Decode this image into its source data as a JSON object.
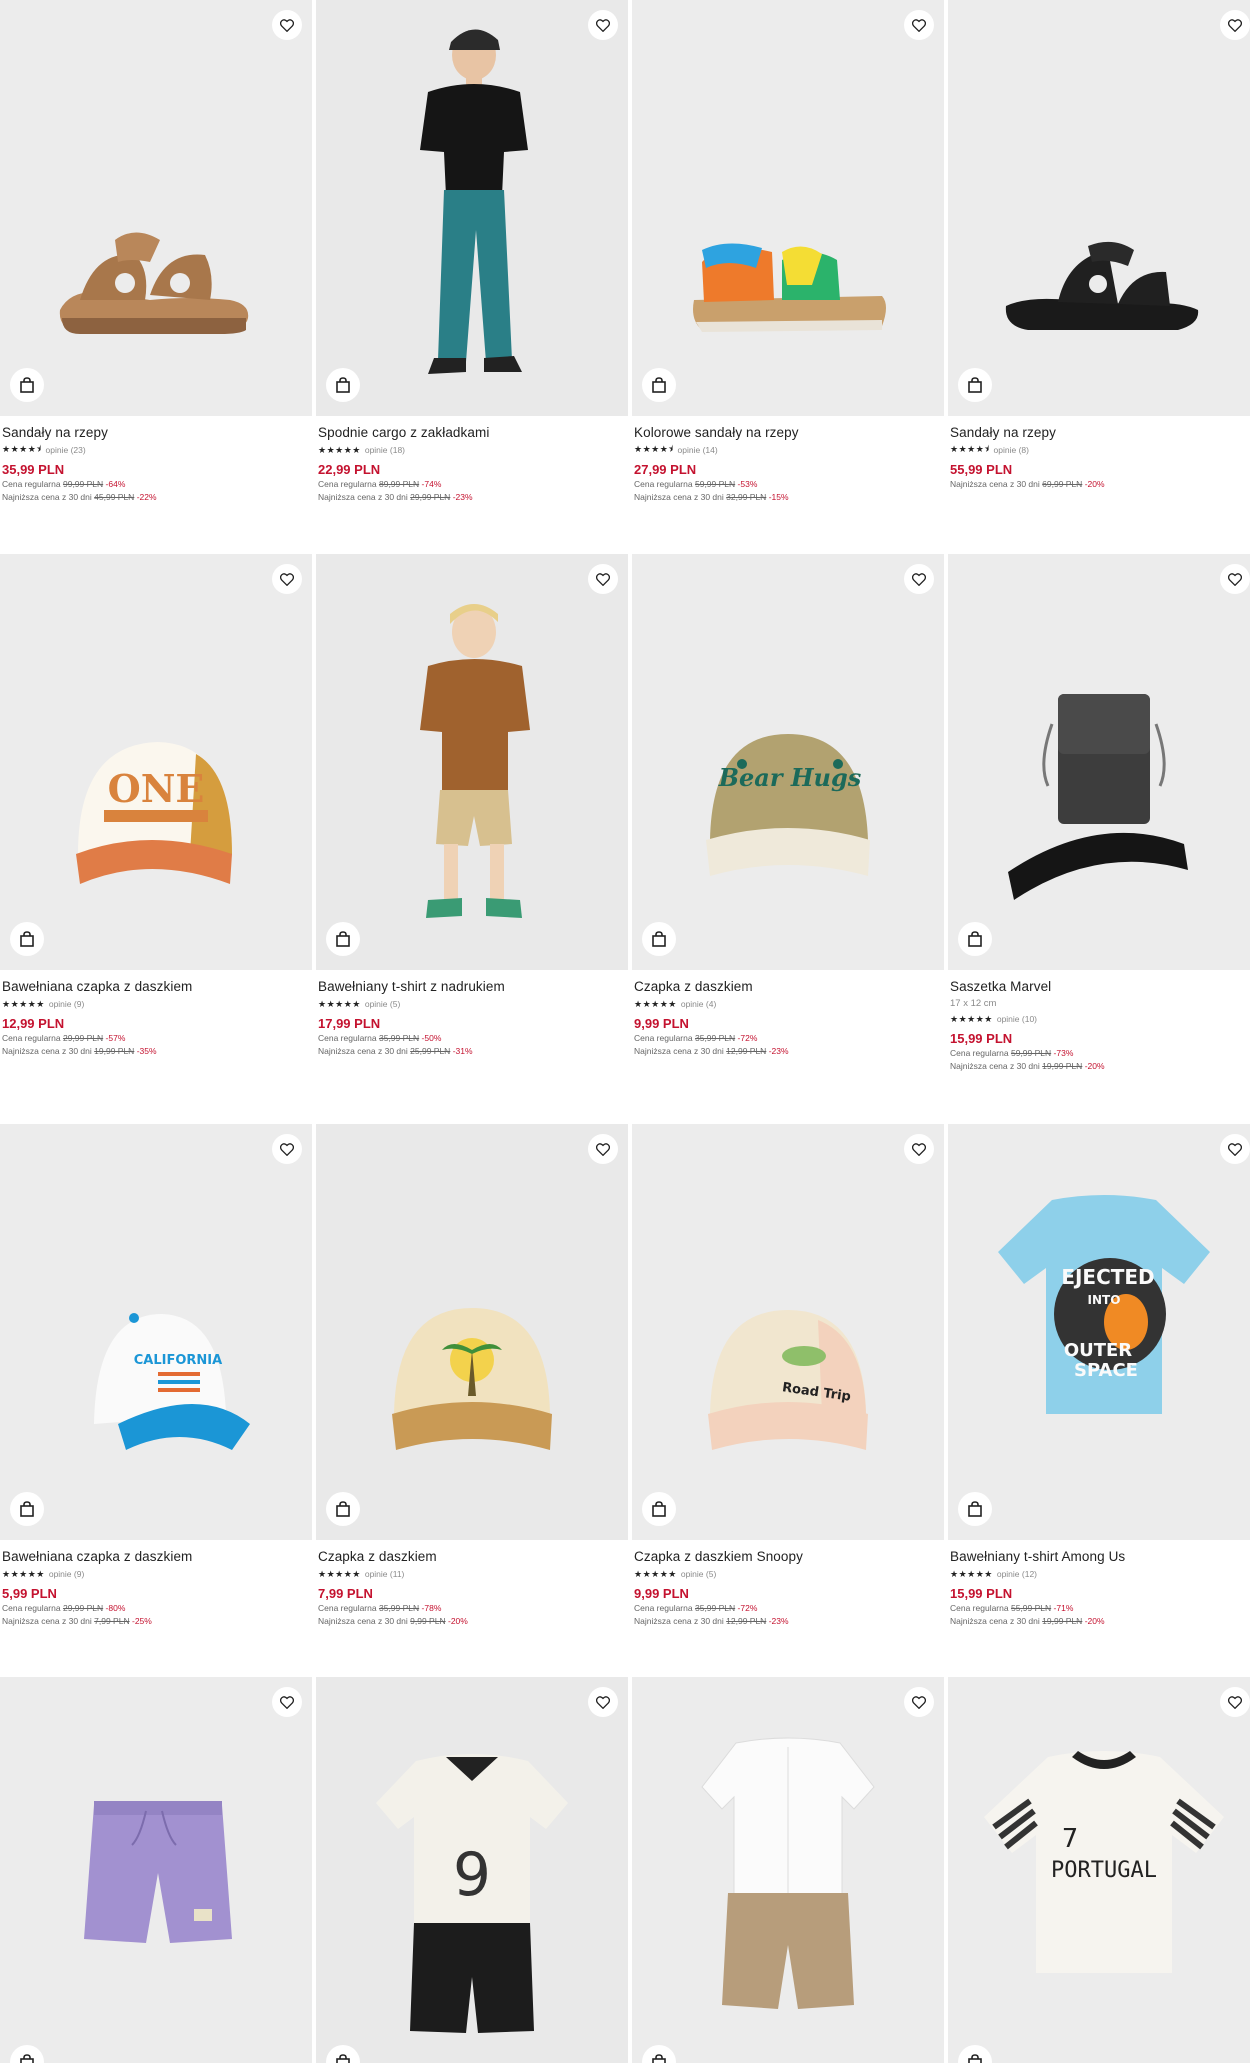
{
  "labels": {
    "regular": "Cena regularna",
    "lowest": "Najniższa cena z 30 dni",
    "reviews_word": "opinie"
  },
  "products": [
    {
      "name": "Sandały na rzepy",
      "stars": "★★★★⯨",
      "reviews": "opinie (23)",
      "price": "35,99 PLN",
      "regular_price": "99,99 PLN",
      "regular_disc": "-64%",
      "lowest_price": "45,99 PLN",
      "lowest_disc": "-22%",
      "icon": "sandal-brown"
    },
    {
      "name": "Spodnie cargo z zakładkami",
      "stars": "★★★★★",
      "reviews": "opinie (18)",
      "price": "22,99 PLN",
      "regular_price": "89,99 PLN",
      "regular_disc": "-74%",
      "lowest_price": "29,99 PLN",
      "lowest_disc": "-23%",
      "icon": "boy-cargo-pants"
    },
    {
      "name": "Kolorowe sandały na rzepy",
      "stars": "★★★★⯨",
      "reviews": "opinie (14)",
      "price": "27,99 PLN",
      "regular_price": "59,99 PLN",
      "regular_disc": "-53%",
      "lowest_price": "32,99 PLN",
      "lowest_disc": "-15%",
      "icon": "sandal-colorful"
    },
    {
      "name": "Sandały na rzepy",
      "stars": "★★★★⯨",
      "reviews": "opinie (8)",
      "price": "55,99 PLN",
      "regular_price": "",
      "regular_disc": "",
      "lowest_price": "69,99 PLN",
      "lowest_disc": "-20%",
      "icon": "sandal-black"
    },
    {
      "name": "Bawełniana czapka z daszkiem",
      "stars": "★★★★★",
      "reviews": "opinie (9)",
      "price": "12,99 PLN",
      "regular_price": "29,99 PLN",
      "regular_disc": "-57%",
      "lowest_price": "19,99 PLN",
      "lowest_disc": "-35%",
      "icon": "cap-one"
    },
    {
      "name": "Bawełniany t-shirt z nadrukiem",
      "stars": "★★★★★",
      "reviews": "opinie (5)",
      "price": "17,99 PLN",
      "regular_price": "35,99 PLN",
      "regular_disc": "-50%",
      "lowest_price": "25,99 PLN",
      "lowest_disc": "-31%",
      "icon": "boy-brown-tshirt"
    },
    {
      "name": "Czapka z daszkiem",
      "stars": "★★★★★",
      "reviews": "opinie (4)",
      "price": "9,99 PLN",
      "regular_price": "35,99 PLN",
      "regular_disc": "-72%",
      "lowest_price": "12,99 PLN",
      "lowest_disc": "-23%",
      "icon": "cap-olive"
    },
    {
      "name": "Saszetka Marvel",
      "subtitle": "17 x 12 cm",
      "stars": "★★★★★",
      "reviews": "opinie (10)",
      "price": "15,99 PLN",
      "regular_price": "59,99 PLN",
      "regular_disc": "-73%",
      "lowest_price": "19,99 PLN",
      "lowest_disc": "-20%",
      "icon": "pouch-marvel"
    },
    {
      "name": "Bawełniana czapka z daszkiem",
      "stars": "★★★★★",
      "reviews": "opinie (9)",
      "price": "5,99 PLN",
      "regular_price": "29,99 PLN",
      "regular_disc": "-80%",
      "lowest_price": "7,99 PLN",
      "lowest_disc": "-25%",
      "icon": "cap-blue-white"
    },
    {
      "name": "Czapka z daszkiem",
      "stars": "★★★★★",
      "reviews": "opinie (11)",
      "price": "7,99 PLN",
      "regular_price": "35,99 PLN",
      "regular_disc": "-78%",
      "lowest_price": "9,99 PLN",
      "lowest_disc": "-20%",
      "icon": "cap-palm"
    },
    {
      "name": "Czapka z daszkiem Snoopy",
      "stars": "★★★★★",
      "reviews": "opinie (5)",
      "price": "9,99 PLN",
      "regular_price": "35,99 PLN",
      "regular_disc": "-72%",
      "lowest_price": "12,99 PLN",
      "lowest_disc": "-23%",
      "icon": "cap-snoopy"
    },
    {
      "name": "Bawełniany t-shirt Among Us",
      "stars": "★★★★★",
      "reviews": "opinie (12)",
      "price": "15,99 PLN",
      "regular_price": "55,99 PLN",
      "regular_disc": "-71%",
      "lowest_price": "19,99 PLN",
      "lowest_disc": "-20%",
      "icon": "tshirt-among-us"
    },
    {
      "name": "",
      "icon": "shorts-purple"
    },
    {
      "name": "",
      "icon": "set-football-9"
    },
    {
      "name": "",
      "icon": "set-shirt-shorts"
    },
    {
      "name": "",
      "icon": "tshirt-portugal"
    }
  ],
  "art_text": {
    "cap_one": "ONE",
    "cap_olive": "Bear Hugs",
    "cap_blue": "CALIFORNIA",
    "cap_snoopy": "Road Trip",
    "amongus_1": "EJECTED",
    "amongus_2": "INTO",
    "amongus_3": "OUTER",
    "amongus_4": "SPACE",
    "football_num": "9",
    "portugal_num": "7",
    "portugal_word": "PORTUGAL"
  },
  "colors": {
    "price_red": "#c4122f",
    "tile_bg": "#ececec"
  }
}
